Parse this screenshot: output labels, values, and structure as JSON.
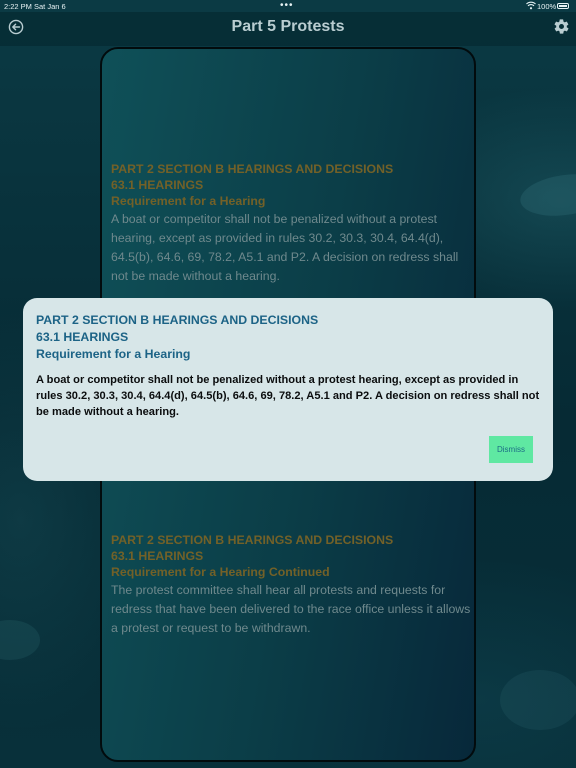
{
  "status_bar": {
    "time": "2:22 PM",
    "date": "Sat Jan 6",
    "battery": "100%"
  },
  "nav": {
    "title": "Part 5 Protests"
  },
  "sections": [
    {
      "part": "PART 2 SECTION B HEARINGS AND DECISIONS",
      "rule": "63.1 HEARINGS",
      "heading": "Requirement for a Hearing",
      "text": "A boat or competitor shall not be penalized without a protest hearing, except as provided in rules 30.2, 30.3, 30.4, 64.4(d), 64.5(b), 64.6, 69, 78.2, A5.1 and P2. A decision on redress shall not be made without a hearing."
    },
    {
      "part": "PART 2 SECTION B HEARINGS AND DECISIONS",
      "rule": "63.1 HEARINGS",
      "heading": "Requirement for a Hearing Continued",
      "text": "The protest committee shall hear all protests and requests for redress that have been delivered to the race office unless it allows a protest or request to be withdrawn."
    }
  ],
  "modal": {
    "part": "PART 2 SECTION B HEARINGS AND DECISIONS",
    "rule": "63.1 HEARINGS",
    "heading": "Requirement for a Hearing",
    "body": "A boat or competitor shall not be penalized without a protest hearing, except as provided in rules 30.2, 30.3, 30.4, 64.4(d), 64.5(b), 64.6, 69, 78.2, A5.1 and P2. A decision on redress shall not be made without a hearing.",
    "dismiss_label": "Dismiss"
  },
  "icons": {
    "back": "back-arrow-circle-icon",
    "settings": "gear-icon",
    "wifi": "wifi-icon",
    "battery": "battery-icon"
  },
  "colors": {
    "accent_heading": "#736128",
    "modal_heading": "#1c6386",
    "dismiss_bg": "#5fe8a2"
  }
}
